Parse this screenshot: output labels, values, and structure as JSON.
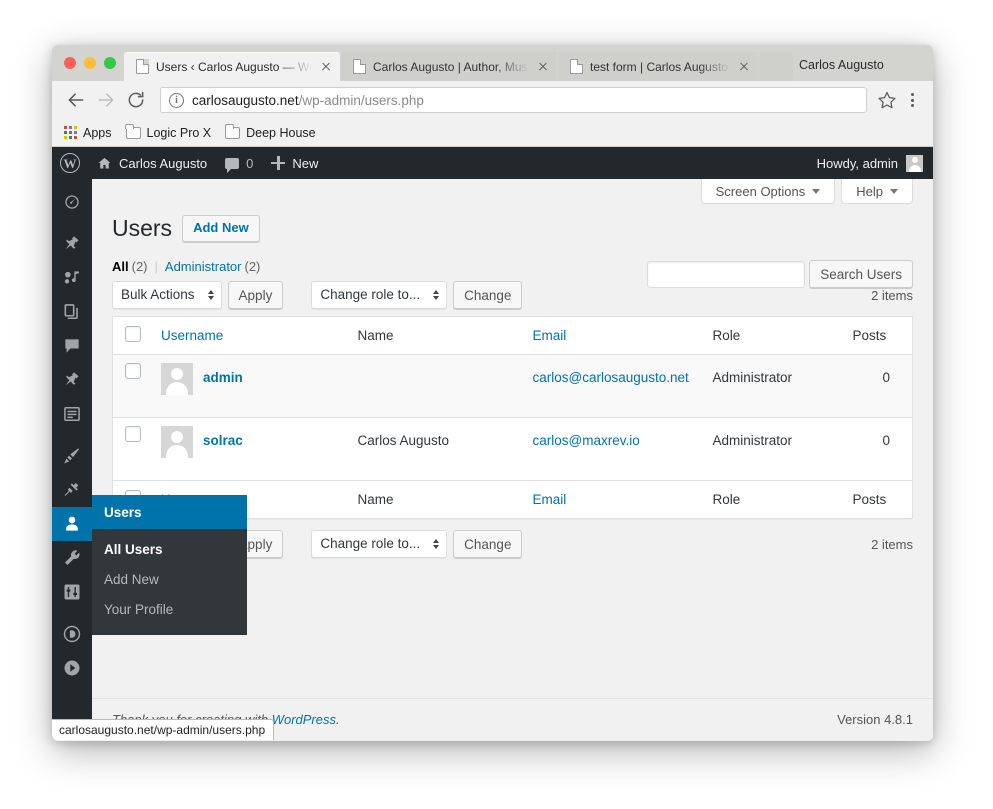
{
  "browser": {
    "window_title_right": "Carlos Augusto",
    "tabs": [
      {
        "title": "Users ‹ Carlos Augusto — Wo",
        "active": true
      },
      {
        "title": "Carlos Augusto | Author, Mus",
        "active": false
      },
      {
        "title": "test form | Carlos Augusto",
        "active": false
      }
    ],
    "omnibox": {
      "host": "carlosaugusto.net",
      "path": "/wp-admin/users.php",
      "info_icon": "info-icon",
      "star_icon": "bookmark-star-icon",
      "menu_icon": "browser-menu-icon"
    },
    "nav": {
      "back": "back-arrow-icon",
      "forward": "forward-arrow-icon",
      "reload": "reload-icon"
    },
    "bookmarks": [
      {
        "label": "Apps",
        "icon": "apps-grid-icon"
      },
      {
        "label": "Logic Pro X",
        "icon": "folder-icon"
      },
      {
        "label": "Deep House",
        "icon": "folder-icon"
      }
    ],
    "status_bubble": "carlosaugusto.net/wp-admin/users.php"
  },
  "adminbar": {
    "logo": "wordpress-logo-icon",
    "site_name": "Carlos Augusto",
    "comments_count": "0",
    "new_label": "New",
    "howdy": "Howdy, admin"
  },
  "sidebar": {
    "items": [
      {
        "name": "dashboard",
        "icon": "dashboard-gauge-icon"
      },
      {
        "name": "posts",
        "icon": "pushpin-icon"
      },
      {
        "name": "media",
        "icon": "media-music-icon"
      },
      {
        "name": "pages",
        "icon": "pages-stack-icon"
      },
      {
        "name": "comments",
        "icon": "comment-bubble-icon"
      },
      {
        "name": "portfolio",
        "icon": "pushpin-icon"
      },
      {
        "name": "forms",
        "icon": "forms-list-icon"
      },
      {
        "name": "appearance",
        "icon": "paintbrush-icon"
      },
      {
        "name": "plugins",
        "icon": "plug-icon"
      },
      {
        "name": "users",
        "icon": "user-silhouette-icon",
        "label": "Users",
        "current": true
      },
      {
        "name": "tools",
        "icon": "wrench-icon"
      },
      {
        "name": "settings",
        "icon": "sliders-icon"
      },
      {
        "name": "divi",
        "icon": "letter-d-circle-icon"
      },
      {
        "name": "collapse",
        "icon": "collapse-arrow-circle-icon"
      }
    ],
    "submenu": [
      {
        "label": "All Users",
        "current": true
      },
      {
        "label": "Add New",
        "current": false
      },
      {
        "label": "Your Profile",
        "current": false
      }
    ]
  },
  "screen_meta": {
    "screen_options": "Screen Options",
    "help": "Help"
  },
  "page": {
    "title": "Users",
    "add_new": "Add New",
    "filters": [
      {
        "label": "All",
        "count": "(2)",
        "current": true
      },
      {
        "label": "Administrator",
        "count": "(2)",
        "current": false
      }
    ],
    "separator": "|"
  },
  "tablenav": {
    "bulk_actions": "Bulk Actions",
    "apply": "Apply",
    "change_role": "Change role to...",
    "change": "Change",
    "items_count": "2 items"
  },
  "search": {
    "value": "",
    "placeholder": "",
    "button": "Search Users"
  },
  "table": {
    "columns": [
      "Username",
      "Name",
      "Email",
      "Role",
      "Posts"
    ],
    "rows": [
      {
        "username": "admin",
        "name": "",
        "email": "carlos@carlosaugusto.net",
        "role": "Administrator",
        "posts": "0"
      },
      {
        "username": "solrac",
        "name": "Carlos Augusto",
        "email": "carlos@maxrev.io",
        "role": "Administrator",
        "posts": "0"
      }
    ]
  },
  "footer": {
    "thanks_pre": "Thank you for creating with ",
    "thanks_link": "WordPress",
    "thanks_post": ".",
    "version": "Version 4.8.1"
  },
  "colors": {
    "wp_dark": "#23282d",
    "wp_submenu": "#32373c",
    "wp_blue": "#0073aa",
    "link_blue": "#0073aa",
    "content_bg": "#f1f1f1"
  }
}
